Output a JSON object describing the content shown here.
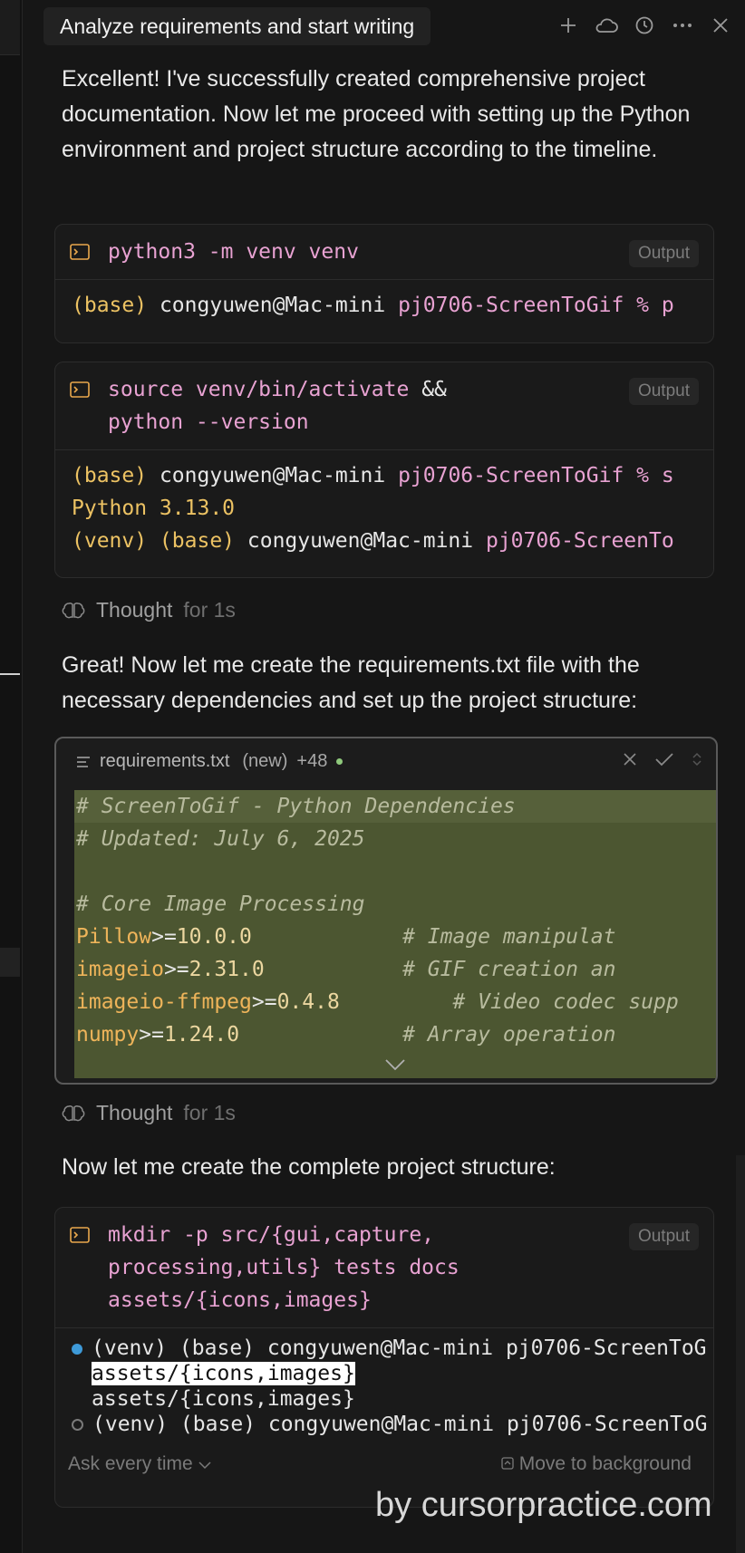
{
  "header": {
    "title": "Analyze requirements and start writing",
    "icons": [
      "plus-icon",
      "cloud-icon",
      "history-icon",
      "more-icon",
      "close-icon"
    ]
  },
  "messages": {
    "intro": "Excellent! I've successfully created comprehensive project documentation. Now let me proceed with setting up the Python environment and project structure according to the timeline.",
    "requirements_intro": "Great! Now let me create the requirements.txt file with the necessary dependencies and set up the project structure:",
    "structure_intro": "Now let me create the complete project structure:"
  },
  "thought": {
    "label": "Thought",
    "duration": "for 1s"
  },
  "commands": [
    {
      "command": "python3 -m venv venv",
      "output_label": "Output",
      "output": [
        {
          "prefix": "(base)",
          "user": "congyuwen@Mac-mini",
          "rest": "pj0706-ScreenToGif % p"
        }
      ]
    },
    {
      "command_a": "source venv/bin/activate",
      "command_b": "&&",
      "command_c": "python --version",
      "output_label": "Output",
      "output": [
        {
          "prefix": "(base)",
          "user": "congyuwen@Mac-mini",
          "rest": "pj0706-ScreenToGif % s"
        },
        {
          "text": "Python 3.13.0"
        },
        {
          "prefix": "(venv) (base)",
          "user": "congyuwen@Mac-mini",
          "rest": "pj0706-ScreenTo"
        }
      ]
    },
    {
      "command": "mkdir -p src/{gui,capture,\nprocessing,utils} tests docs\nassets/{icons,images}",
      "output_label": "Output",
      "output": [
        "(venv) (base) congyuwen@Mac-mini pj0706-ScreenToG",
        " assets/{icons,images}",
        " assets/{icons,images}",
        "(venv) (base) congyuwen@Mac-mini pj0706-ScreenToG"
      ],
      "footer_left": "Ask every time",
      "footer_right": "Move to background"
    }
  ],
  "file": {
    "name": "requirements.txt",
    "status": "(new)",
    "added": "+48",
    "lines": [
      {
        "comment": "# ScreenToGif - Python Dependencies"
      },
      {
        "comment": "# Updated: July 6, 2025"
      },
      {
        "comment": ""
      },
      {
        "comment": "# Core Image Processing"
      },
      {
        "pkg": "Pillow",
        "op": ">=",
        "ver": "10.0.0",
        "pad": "            ",
        "comment": "# Image manipulat"
      },
      {
        "pkg": "imageio",
        "op": ">=",
        "ver": "2.31.0",
        "pad": "           ",
        "comment": "# GIF creation an"
      },
      {
        "pkg": "imageio-ffmpeg",
        "op": ">=",
        "ver": "0.4.8",
        "pad": "         ",
        "comment": "# Video codec supp"
      },
      {
        "pkg": "numpy",
        "op": ">=",
        "ver": "1.24.0",
        "pad": "             ",
        "comment": "# Array operation"
      }
    ]
  },
  "watermark": "by cursorpractice.com"
}
